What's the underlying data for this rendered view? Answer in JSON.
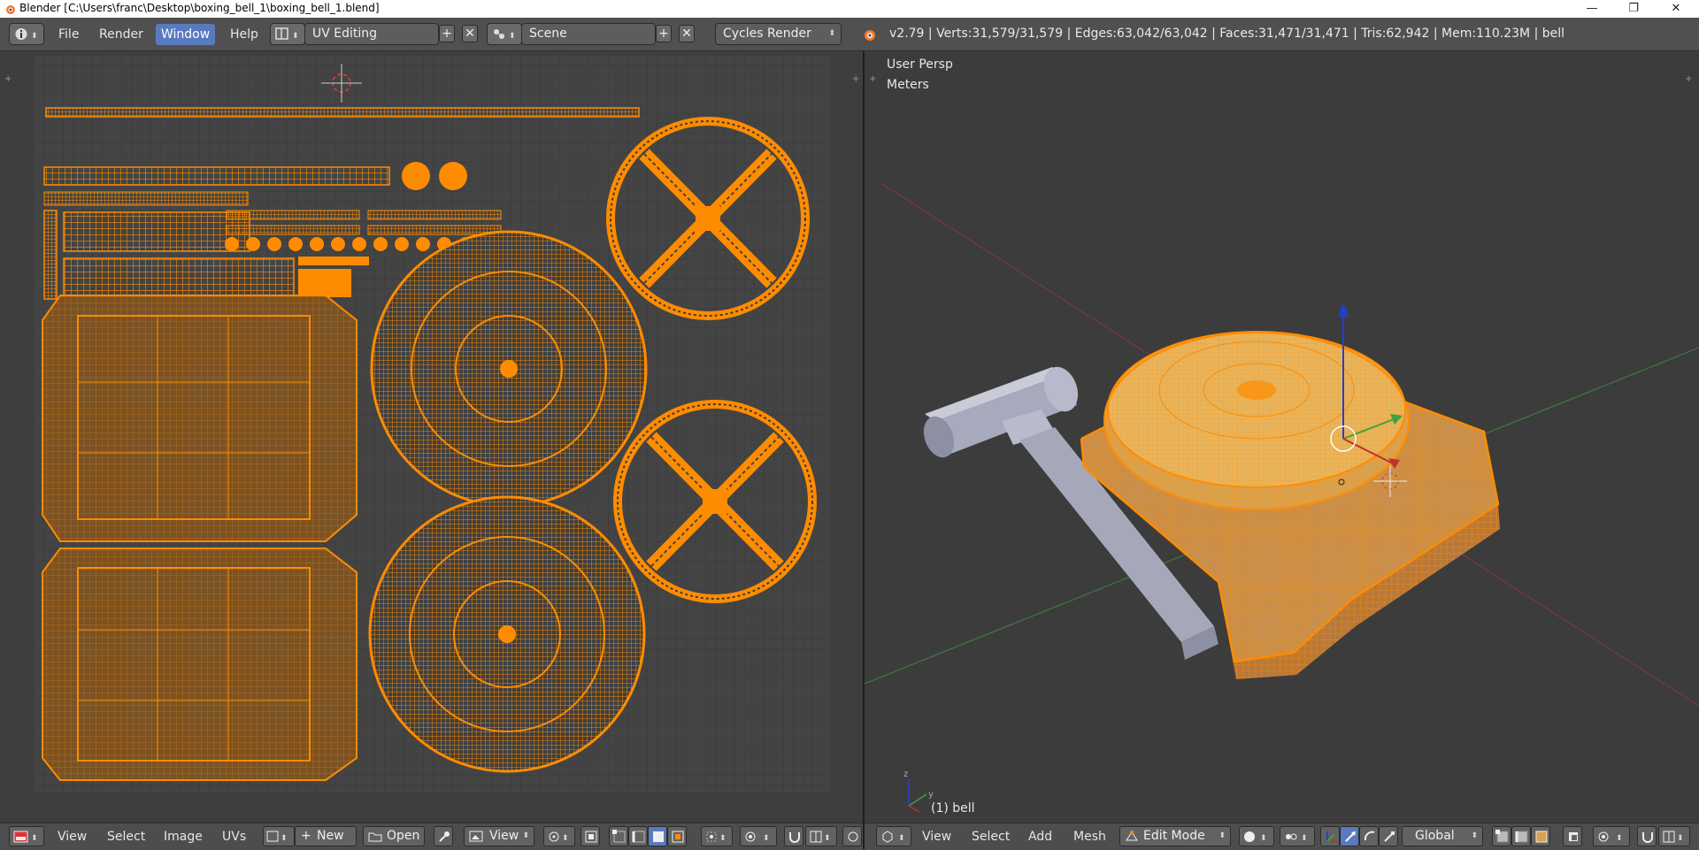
{
  "window": {
    "title": "Blender [C:\\Users\\franc\\Desktop\\boxing_bell_1\\boxing_bell_1.blend]",
    "minimize_glyph": "—",
    "maximize_glyph": "❐",
    "close_glyph": "✕"
  },
  "info_header": {
    "menus": [
      "File",
      "Render",
      "Window",
      "Help"
    ],
    "active_menu": "Window",
    "screen_layout": "UV Editing",
    "scene": "Scene",
    "render_engine": "Cycles Render",
    "stats": "v2.79 | Verts:31,579/31,579 | Edges:63,042/63,042 | Faces:31,471/31,471 | Tris:62,942 | Mem:110.23M | bell"
  },
  "viewport": {
    "view_name": "User Persp",
    "units": "Meters",
    "object_label": "(1) bell"
  },
  "uv_header": {
    "menus": [
      "View",
      "Select",
      "Image",
      "UVs"
    ],
    "new_label": "New",
    "open_label": "Open",
    "view_dropdown": "View"
  },
  "view3d_header": {
    "menus": [
      "View",
      "Select",
      "Add",
      "Mesh"
    ],
    "mode": "Edit Mode",
    "orientation": "Global"
  },
  "colors": {
    "accent_selected": "#ff8c00",
    "menu_highlight": "#5a7ac0",
    "background": "#3d3d3d",
    "x_axis": "#c23030",
    "y_axis": "#40a040",
    "z_axis": "#2040d0"
  }
}
